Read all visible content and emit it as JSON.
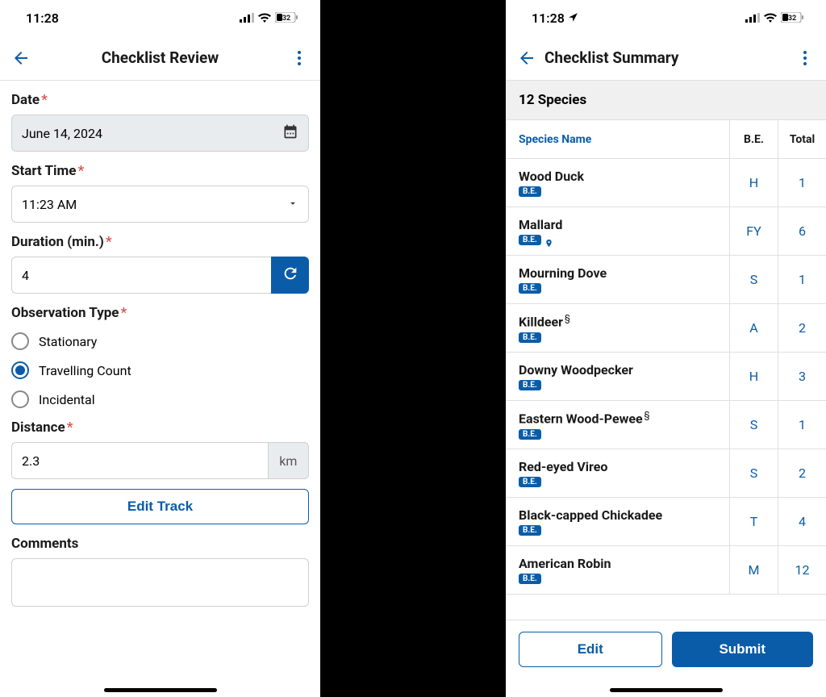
{
  "status": {
    "time": "11:28",
    "battery": "32"
  },
  "left": {
    "title": "Checklist Review",
    "labels": {
      "date": "Date",
      "start": "Start Time",
      "duration": "Duration (min.)",
      "obs": "Observation Type",
      "distance": "Distance",
      "comments": "Comments"
    },
    "fields": {
      "date": "June 14, 2024",
      "start": "11:23 AM",
      "duration": "4",
      "distance": "2.3",
      "distance_unit": "km"
    },
    "radios": {
      "stationary": "Stationary",
      "travelling": "Travelling Count",
      "incidental": "Incidental"
    },
    "edit_track": "Edit Track"
  },
  "right": {
    "title": "Checklist Summary",
    "count_label": "12 Species",
    "headers": {
      "name": "Species Name",
      "be": "B.E.",
      "total": "Total"
    },
    "badge": "B.E.",
    "species": [
      {
        "name": "Wood Duck",
        "be": "H",
        "total": "1",
        "super": "",
        "pin": false
      },
      {
        "name": "Mallard",
        "be": "FY",
        "total": "6",
        "super": "",
        "pin": true
      },
      {
        "name": "Mourning Dove",
        "be": "S",
        "total": "1",
        "super": "",
        "pin": false
      },
      {
        "name": "Killdeer",
        "be": "A",
        "total": "2",
        "super": "§",
        "pin": false
      },
      {
        "name": "Downy Woodpecker",
        "be": "H",
        "total": "3",
        "super": "",
        "pin": false
      },
      {
        "name": "Eastern Wood-Pewee",
        "be": "S",
        "total": "1",
        "super": "§",
        "pin": false
      },
      {
        "name": "Red-eyed Vireo",
        "be": "S",
        "total": "2",
        "super": "",
        "pin": false
      },
      {
        "name": "Black-capped Chickadee",
        "be": "T",
        "total": "4",
        "super": "",
        "pin": false
      },
      {
        "name": "American Robin",
        "be": "M",
        "total": "12",
        "super": "",
        "pin": false
      }
    ],
    "buttons": {
      "edit": "Edit",
      "submit": "Submit"
    }
  }
}
